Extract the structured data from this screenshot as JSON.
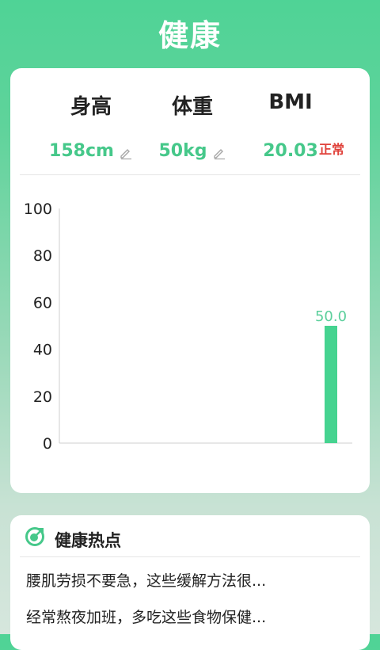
{
  "app": {
    "title": "健康"
  },
  "metrics": {
    "height": {
      "label": "身高",
      "value": "158cm"
    },
    "weight": {
      "label": "体重",
      "value": "50kg"
    },
    "bmi": {
      "label": "BMI",
      "value": "20.03",
      "status": "正常"
    }
  },
  "chart_data": {
    "type": "bar",
    "categories": [
      "",
      "",
      "",
      "",
      ""
    ],
    "values": [
      null,
      null,
      null,
      null,
      50.0
    ],
    "value_labels": [
      "",
      "",
      "",
      "",
      "50.0"
    ],
    "yticks": [
      "0",
      "20",
      "40",
      "60",
      "80",
      "100"
    ],
    "ylim": [
      0,
      100
    ],
    "bar_color": "#46d390",
    "label_color": "#5ccf9c",
    "grid": false
  },
  "news": {
    "title": "健康热点",
    "items": [
      "腰肌劳损不要急，这些缓解方法很...",
      "经常熬夜加班，多吃这些食物保健..."
    ]
  },
  "colors": {
    "accent": "#46c88a",
    "status": "#e0413a"
  }
}
